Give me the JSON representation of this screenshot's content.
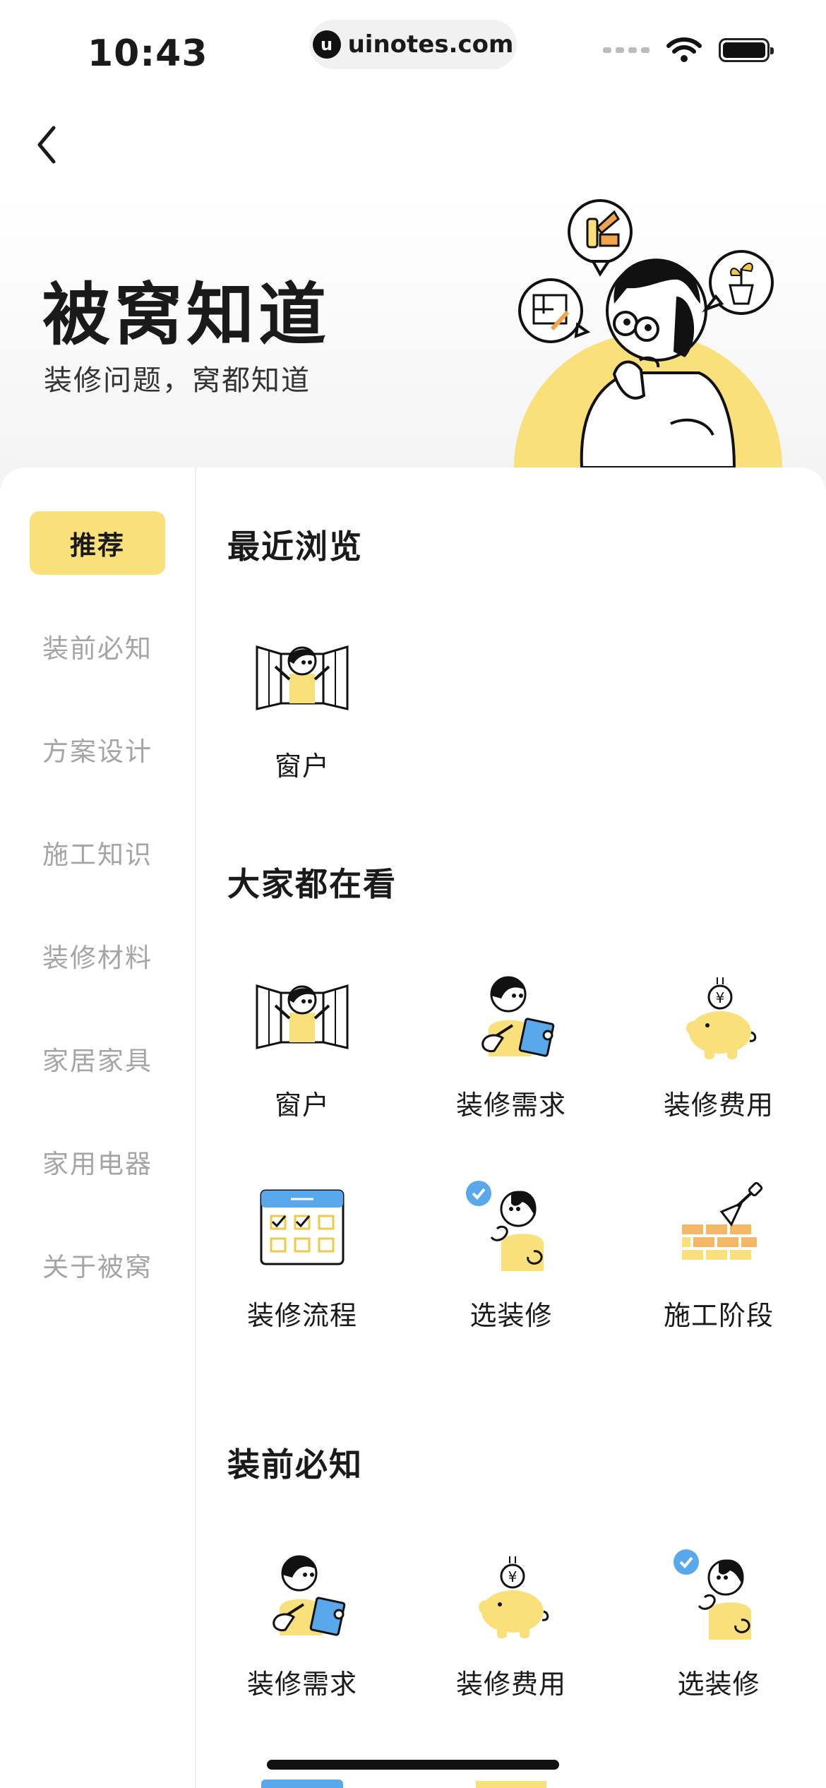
{
  "status_bar": {
    "time": "10:43",
    "url": "uinotes.com",
    "url_logo_glyph": "u"
  },
  "header": {
    "title": "被窝知道",
    "subtitle": "装修问题，窝都知道"
  },
  "sidebar": {
    "items": [
      {
        "label": "推荐",
        "active": true
      },
      {
        "label": "装前必知",
        "active": false
      },
      {
        "label": "方案设计",
        "active": false
      },
      {
        "label": "施工知识",
        "active": false
      },
      {
        "label": "装修材料",
        "active": false
      },
      {
        "label": "家居家具",
        "active": false
      },
      {
        "label": "家用电器",
        "active": false
      },
      {
        "label": "关于被窝",
        "active": false
      }
    ]
  },
  "sections": {
    "recent": {
      "title": "最近浏览",
      "items": [
        {
          "label": "窗户",
          "icon": "window-person-icon"
        }
      ]
    },
    "popular": {
      "title": "大家都在看",
      "items": [
        {
          "label": "窗户",
          "icon": "window-person-icon"
        },
        {
          "label": "装修需求",
          "icon": "notebook-person-icon"
        },
        {
          "label": "装修费用",
          "icon": "piggy-bank-icon"
        },
        {
          "label": "装修流程",
          "icon": "calendar-checklist-icon"
        },
        {
          "label": "选装修",
          "icon": "thinking-person-icon"
        },
        {
          "label": "施工阶段",
          "icon": "brick-trowel-icon"
        }
      ]
    },
    "before": {
      "title": "装前必知",
      "items": [
        {
          "label": "装修需求",
          "icon": "notebook-person-icon"
        },
        {
          "label": "装修费用",
          "icon": "piggy-bank-icon"
        },
        {
          "label": "选装修",
          "icon": "thinking-person-icon"
        }
      ]
    }
  },
  "colors": {
    "accent_yellow": "#f9e07a",
    "accent_blue": "#5aa8ec",
    "brick_orange": "#f0a54a",
    "muted_text": "#a5a5a5"
  }
}
